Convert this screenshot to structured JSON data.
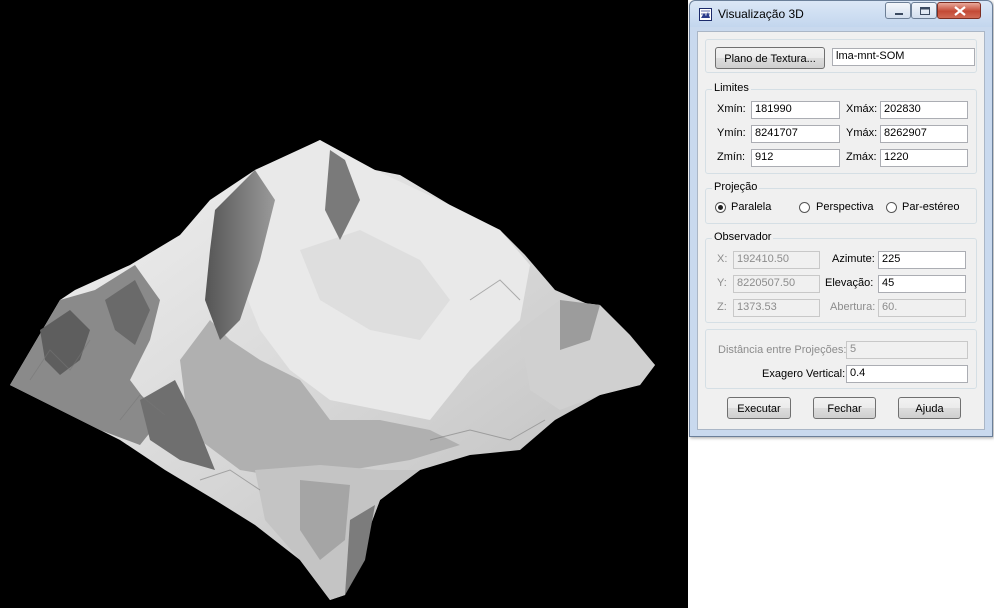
{
  "window": {
    "title": "Visualização 3D",
    "icon": "visualization-3d-icon"
  },
  "texture": {
    "button_label": "Plano de Textura...",
    "value": "lma-mnt-SOM"
  },
  "limits": {
    "legend": "Limites",
    "xmin_label": "Xmín:",
    "xmin": "181990",
    "xmax_label": "Xmáx:",
    "xmax": "202830",
    "ymin_label": "Ymín:",
    "ymin": "8241707",
    "ymax_label": "Ymáx:",
    "ymax": "8262907",
    "zmin_label": "Zmín:",
    "zmin": "912",
    "zmax_label": "Zmáx:",
    "zmax": "1220"
  },
  "projection": {
    "legend": "Projeção",
    "options": [
      "Paralela",
      "Perspectiva",
      "Par-estéreo"
    ],
    "selected": "Paralela"
  },
  "observer": {
    "legend": "Observador",
    "x_label": "X:",
    "x": "192410.50",
    "y_label": "Y:",
    "y": "8220507.50",
    "z_label": "Z:",
    "z": "1373.53",
    "azimuth_label": "Azimute:",
    "azimuth": "225",
    "elevation_label": "Elevação:",
    "elevation": "45",
    "aperture_label": "Abertura:",
    "aperture": "60."
  },
  "settings": {
    "distance_label": "Distância entre Projeções:",
    "distance": "5",
    "exaggeration_label": "Exagero Vertical:",
    "exaggeration": "0.4"
  },
  "buttons": {
    "execute": "Executar",
    "close": "Fechar",
    "help": "Ajuda"
  }
}
